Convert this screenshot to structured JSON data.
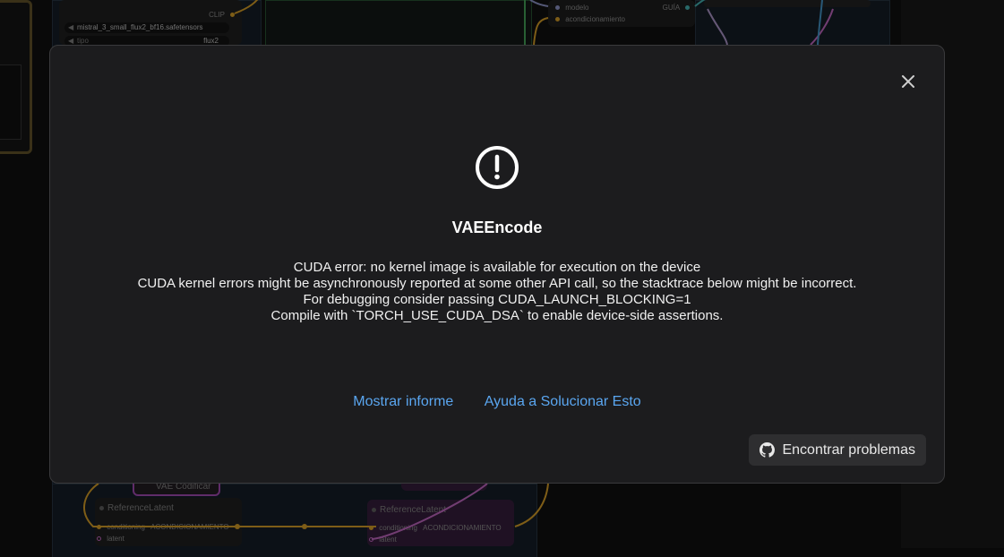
{
  "background": {
    "top_left_node": {
      "clip_output": "CLIP",
      "model_widget": "mistral_3_small_flux2_bf16.safetensors",
      "type_widget_label": "tipo",
      "type_widget_value": "flux2"
    },
    "top_right_node": {
      "input_model": "modelo",
      "input_conditioning": "acondicionamiento",
      "output_guide": "GUÍA"
    },
    "bottom_left_node": {
      "title": "ReferenceLatent",
      "input_conditioning": "conditioning",
      "output_conditioning": "ACONDICIONAMIENTO",
      "input_latent": "latent"
    },
    "bottom_center_node": {
      "title": "VAE Codificar"
    },
    "bottom_right_node": {
      "title": "ReferenceLatent",
      "input_conditioning": "conditioning",
      "output_conditioning": "ACONDICIONAMIENTO",
      "input_latent": "latent"
    },
    "colors": {
      "wire_clip": "#e5a92a",
      "wire_latent": "#d070d0",
      "wire_blue": "#4aa0d8",
      "wire_green": "#4ab060"
    }
  },
  "dialog": {
    "title": "VAEEncode",
    "message_lines": [
      "CUDA error: no kernel image is available for execution on the device",
      "CUDA kernel errors might be asynchronously reported at some other API call, so the stacktrace below might be incorrect.",
      "For debugging consider passing CUDA_LAUNCH_BLOCKING=1",
      "Compile with `TORCH_USE_CUDA_DSA` to enable device-side assertions."
    ],
    "show_report_link": "Mostrar informe",
    "help_fix_link": "Ayuda a Solucionar Esto",
    "find_issues_button": "Encontrar problemas",
    "icons": {
      "close": "close-icon",
      "alert": "alert-circle-icon",
      "github": "github-icon"
    },
    "accent_color": "#5aa6f0"
  }
}
